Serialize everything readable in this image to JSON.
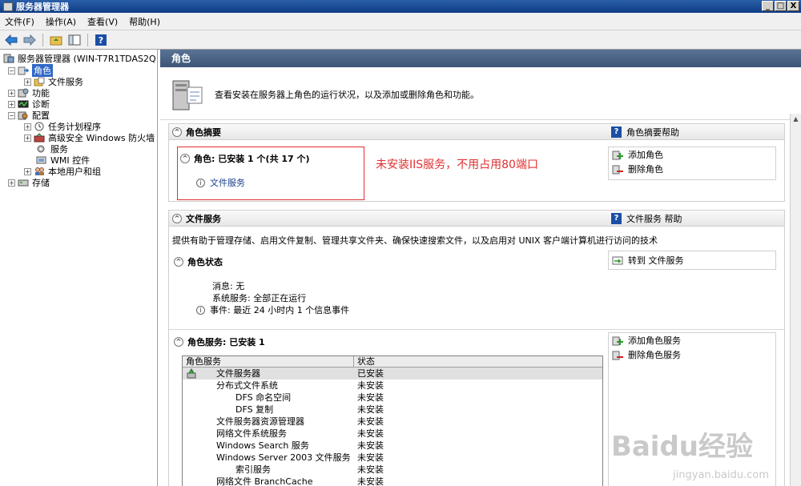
{
  "window": {
    "title": "服务器管理器",
    "min": "_",
    "max": "□",
    "close": "X"
  },
  "menu": [
    "文件(F)",
    "操作(A)",
    "查看(V)",
    "帮助(H)"
  ],
  "tree": {
    "root": "服务器管理器 (WIN-T7R1TDAS2Q",
    "roles": "角色",
    "file_services": "文件服务",
    "features": "功能",
    "diagnostics": "诊断",
    "config": "配置",
    "task_scheduler": "任务计划程序",
    "firewall": "高级安全 Windows 防火墙",
    "services": "服务",
    "wmi": "WMI 控件",
    "local_users": "本地用户和组",
    "storage": "存储"
  },
  "content": {
    "header": "角色",
    "banner_text": "查看安装在服务器上角色的运行状况，以及添加或删除角色和功能。",
    "summary": {
      "title": "角色摘要",
      "help": "角色摘要帮助",
      "roles_line": "角色: 已安装 1 个(共 17 个)",
      "file_service_link": "文件服务",
      "add_role": "添加角色",
      "remove_role": "删除角色",
      "annotation": "未安装IIS服务，不用占用80端口"
    },
    "file_services": {
      "title": "文件服务",
      "help": "文件服务 帮助",
      "desc": "提供有助于管理存储、启用文件复制、管理共享文件夹、确保快速搜索文件，以及启用对 UNIX 客户端计算机进行访问的技术",
      "role_status": "角色状态",
      "goto": "转到 文件服务",
      "messages": "消息: 无",
      "system_services": "系统服务: 全部正在运行",
      "events": "事件: 最近 24 小时内 1 个信息事件",
      "role_services_line": "角色服务: 已安装 1",
      "add_role_services": "添加角色服务",
      "remove_role_services": "删除角色服务",
      "col_name": "角色服务",
      "col_status": "状态",
      "rows": [
        {
          "name": "文件服务器",
          "status": "已安装",
          "indent": 0
        },
        {
          "name": "分布式文件系统",
          "status": "未安装",
          "indent": 0
        },
        {
          "name": "DFS 命名空间",
          "status": "未安装",
          "indent": 1
        },
        {
          "name": "DFS 复制",
          "status": "未安装",
          "indent": 1
        },
        {
          "name": "文件服务器资源管理器",
          "status": "未安装",
          "indent": 0
        },
        {
          "name": "网络文件系统服务",
          "status": "未安装",
          "indent": 0
        },
        {
          "name": "Windows Search 服务",
          "status": "未安装",
          "indent": 0
        },
        {
          "name": "Windows Server 2003 文件服务",
          "status": "未安装",
          "indent": 0
        },
        {
          "name": "索引服务",
          "status": "未安装",
          "indent": 1
        },
        {
          "name": "网络文件 BranchCache",
          "status": "未安装",
          "indent": 0
        }
      ]
    }
  },
  "watermark": {
    "main": "Baidu经验",
    "sub": "jingyan.baidu.com"
  },
  "colors": {
    "accent": "#3169c6",
    "annotation": "#e03030",
    "header": "#4a6485"
  }
}
